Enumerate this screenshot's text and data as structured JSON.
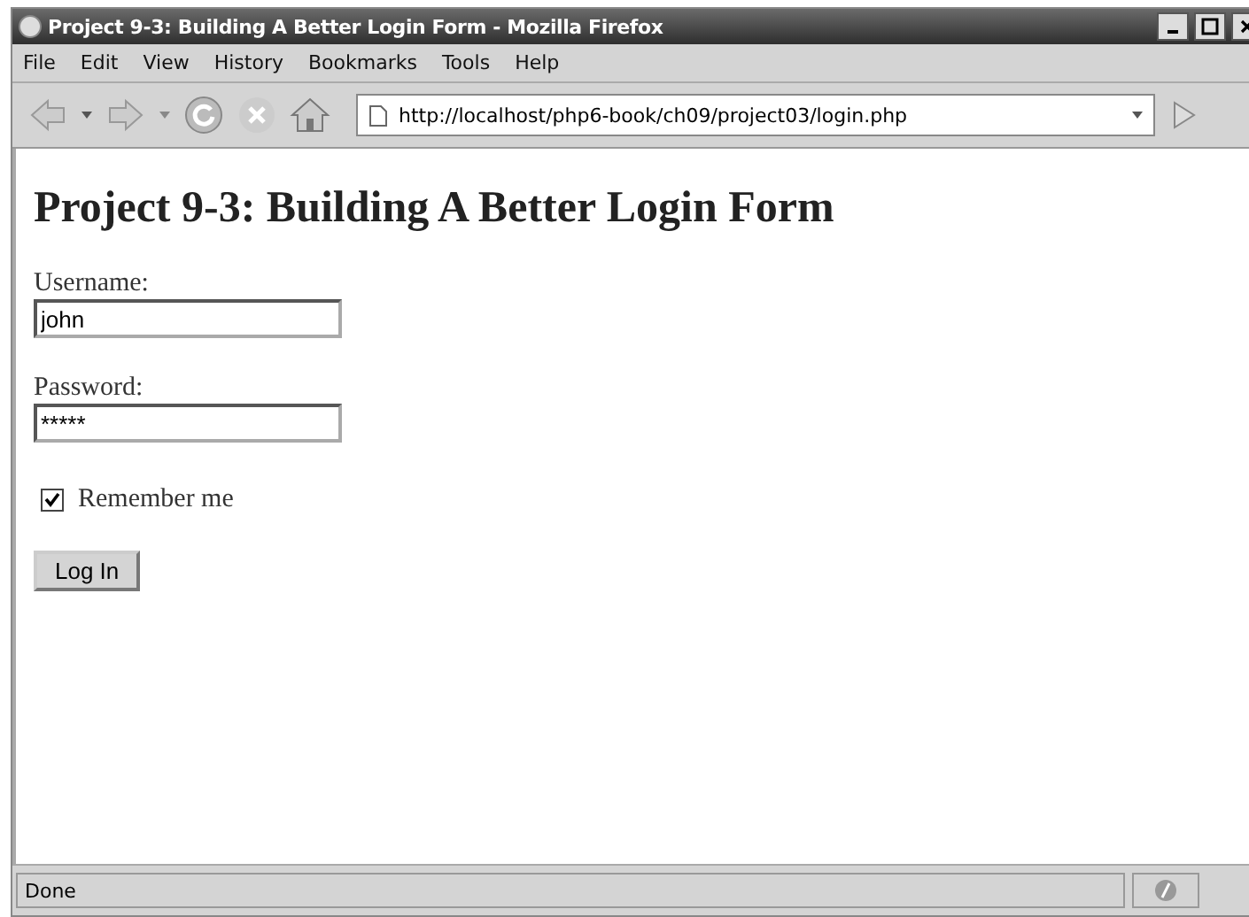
{
  "window": {
    "title": "Project 9-3: Building A Better Login Form - Mozilla Firefox"
  },
  "menu": [
    "File",
    "Edit",
    "View",
    "History",
    "Bookmarks",
    "Tools",
    "Help"
  ],
  "address_bar": {
    "value": "http://localhost/php6-book/ch09/project03/login.php"
  },
  "page": {
    "heading": "Project 9-3: Building A Better Login Form",
    "username": {
      "label": "Username:",
      "value": "john"
    },
    "password": {
      "label": "Password:",
      "value": "*****"
    },
    "remember": {
      "label": "Remember me",
      "checked": true
    },
    "submit": "Log In"
  },
  "status_bar": {
    "text": "Done"
  }
}
